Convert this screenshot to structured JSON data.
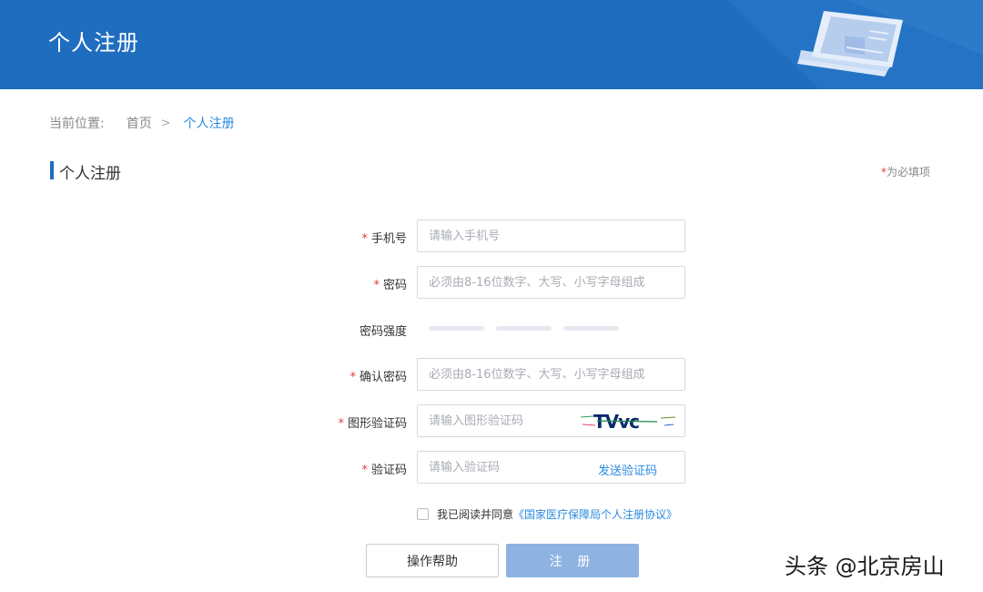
{
  "header": {
    "title": "个人注册"
  },
  "breadcrumb": {
    "label": "当前位置:",
    "home": "首页",
    "separator": ">",
    "current": "个人注册"
  },
  "section": {
    "title": "个人注册",
    "required_note_star": "*",
    "required_note": "为必填项"
  },
  "form": {
    "phone": {
      "label": "手机号",
      "placeholder": "请输入手机号"
    },
    "password": {
      "label": "密码",
      "placeholder": "必须由8-16位数字、大写、小写字母组成"
    },
    "strength": {
      "label": "密码强度",
      "level": 0
    },
    "confirm": {
      "label": "确认密码",
      "placeholder": "必须由8-16位数字、大写、小写字母组成"
    },
    "captcha": {
      "label": "图形验证码",
      "placeholder": "请输入图形验证码",
      "image_text": "TVvc"
    },
    "sms": {
      "label": "验证码",
      "placeholder": "请输入验证码",
      "send_label": "发送验证码"
    },
    "agreement": {
      "text": "我已阅读并同意",
      "link": "《国家医疗保障局个人注册协议》",
      "checked": false
    }
  },
  "buttons": {
    "help": "操作帮助",
    "register": "注 册"
  },
  "watermark": "头条 @北京房山",
  "colors": {
    "header": "#1f6dbf",
    "accent": "#2a8ae0",
    "required": "#e4393c",
    "register_button": "#8fb3e0"
  }
}
